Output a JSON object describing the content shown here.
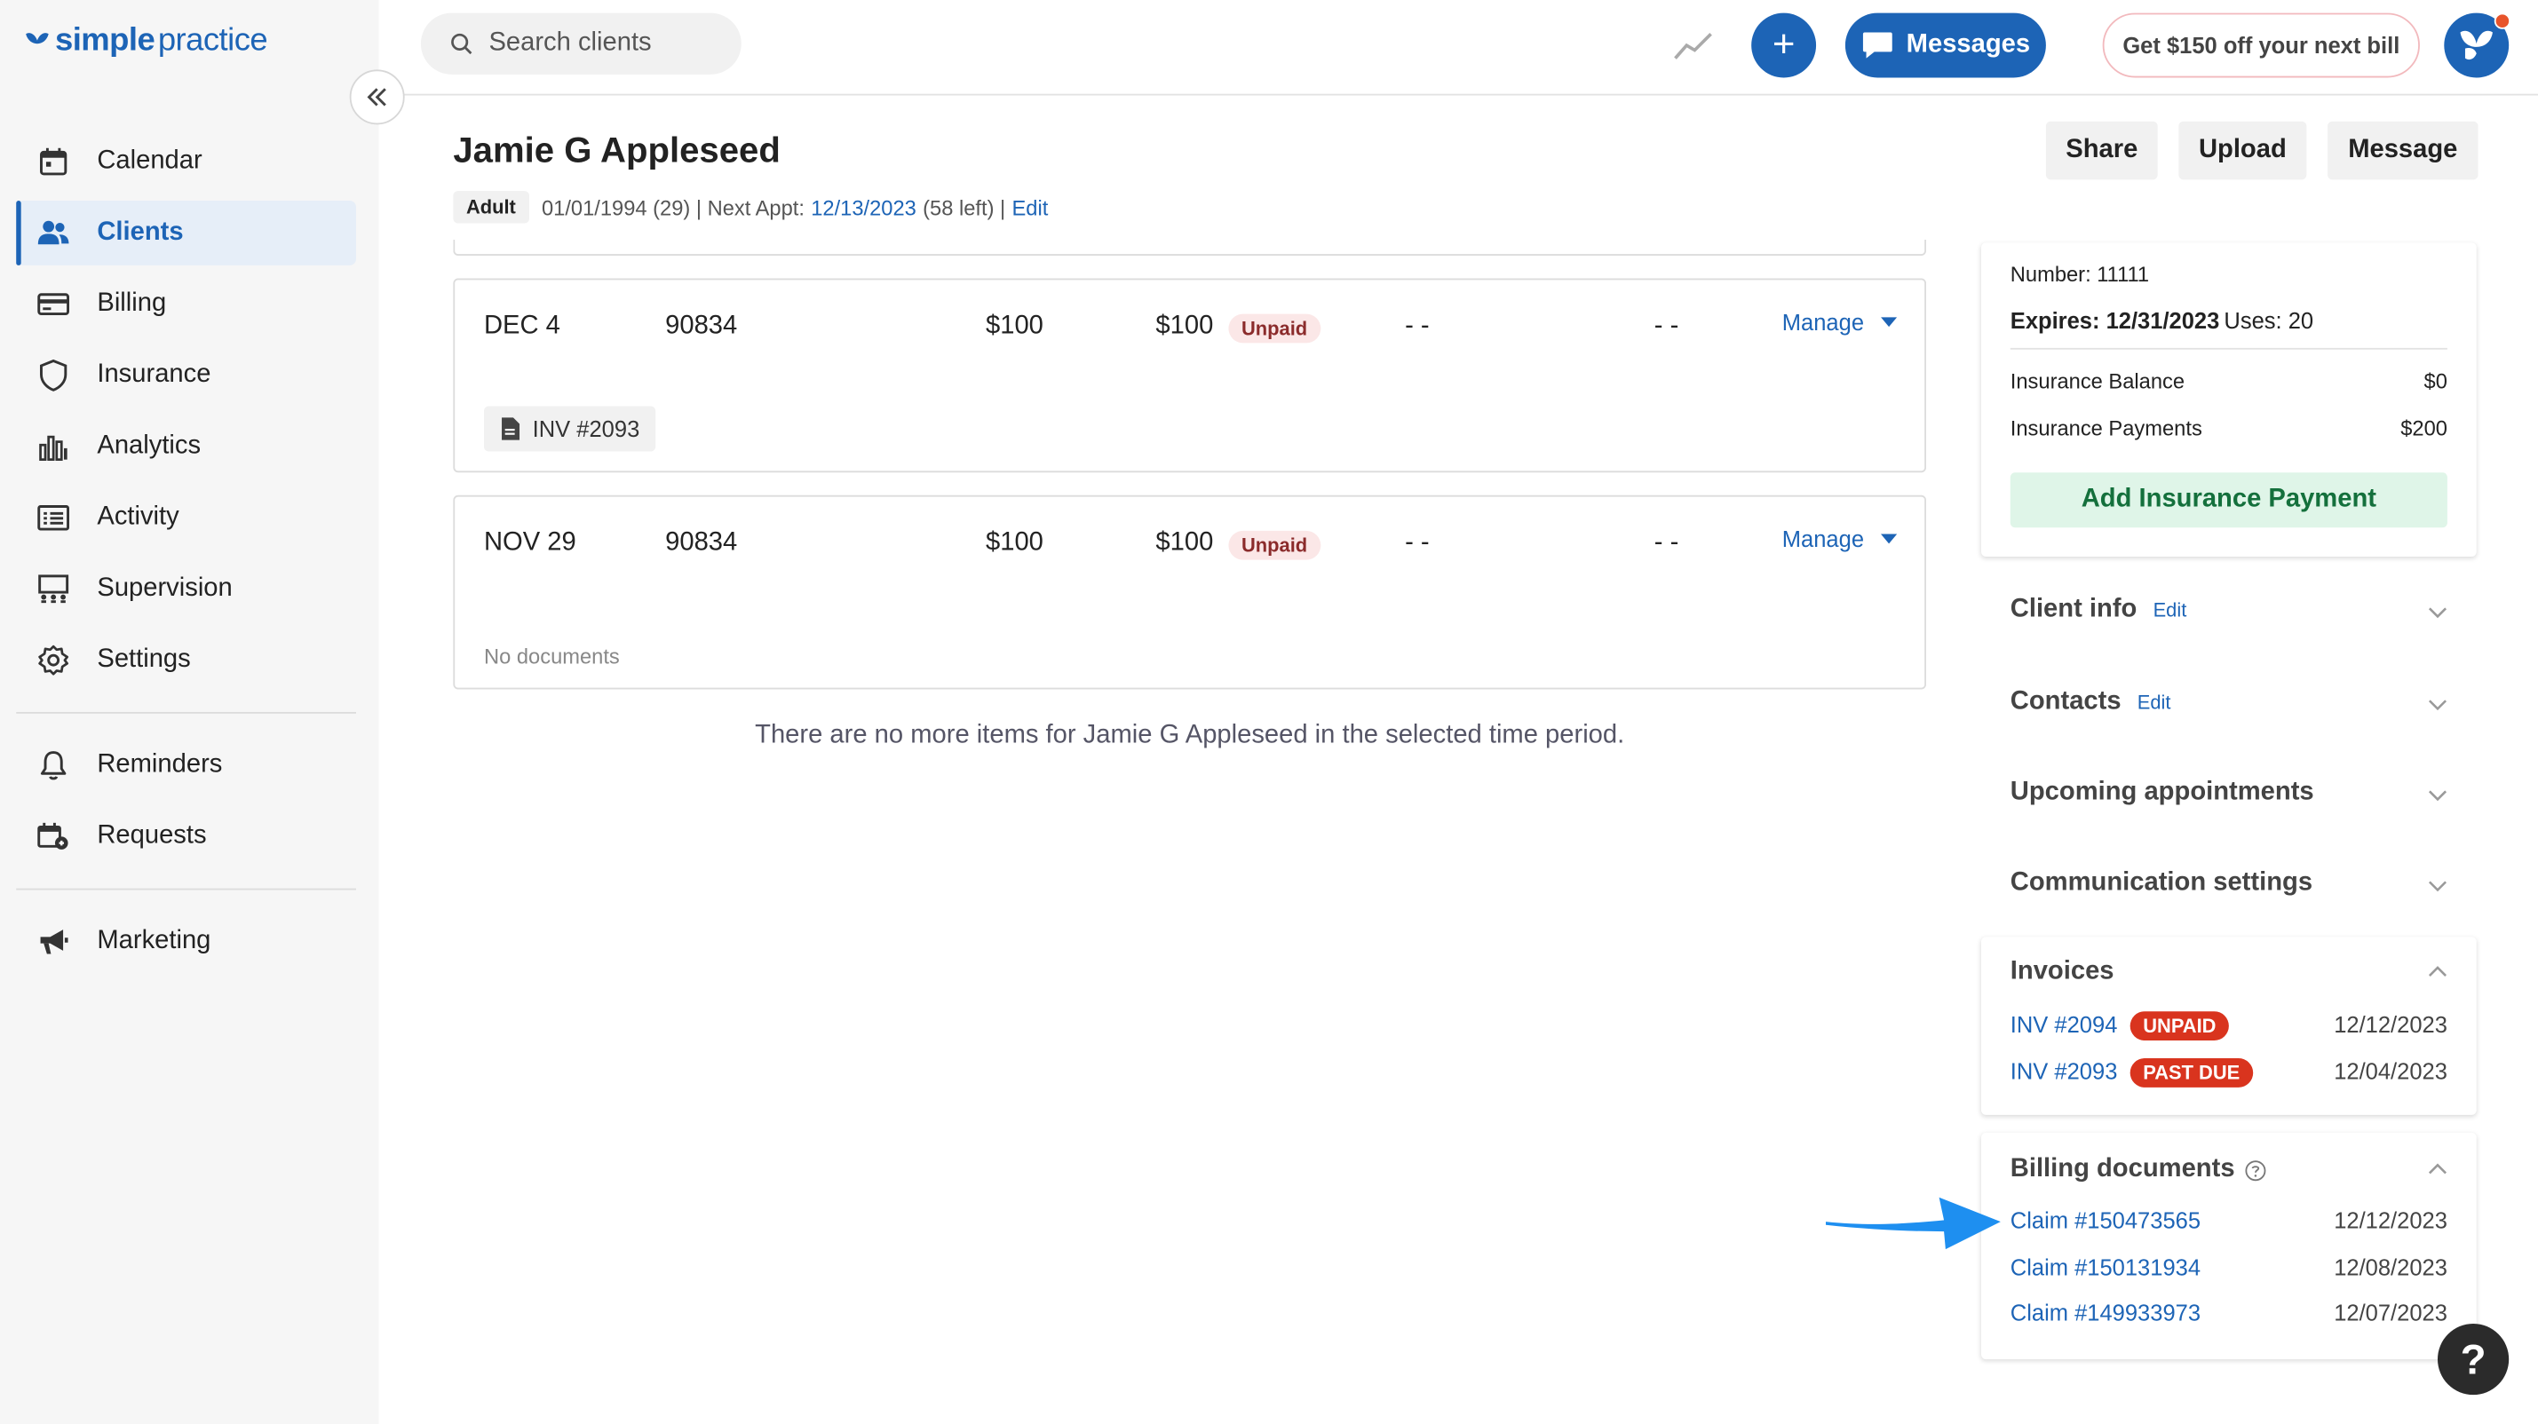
{
  "brand": {
    "part1": "simple",
    "part2": "practice"
  },
  "sidebar": {
    "items": [
      {
        "label": "Calendar",
        "icon": "calendar-icon"
      },
      {
        "label": "Clients",
        "icon": "clients-icon",
        "active": true
      },
      {
        "label": "Billing",
        "icon": "billing-icon"
      },
      {
        "label": "Insurance",
        "icon": "insurance-icon"
      },
      {
        "label": "Analytics",
        "icon": "analytics-icon"
      },
      {
        "label": "Activity",
        "icon": "activity-icon"
      },
      {
        "label": "Supervision",
        "icon": "supervision-icon"
      },
      {
        "label": "Settings",
        "icon": "settings-icon"
      }
    ],
    "items2": [
      {
        "label": "Reminders",
        "icon": "bell-icon"
      },
      {
        "label": "Requests",
        "icon": "requests-icon"
      }
    ],
    "items3": [
      {
        "label": "Marketing",
        "icon": "megaphone-icon"
      }
    ]
  },
  "topbar": {
    "search_placeholder": "Search clients",
    "messages_label": "Messages",
    "promo_label": "Get $150 off your next bill"
  },
  "client": {
    "name": "Jamie G Appleseed",
    "badge": "Adult",
    "meta_prefix": "01/01/1994 (29) | Next Appt:",
    "next_appt": "12/13/2023",
    "meta_suffix": "(58 left) |",
    "edit": "Edit"
  },
  "header_buttons": {
    "share": "Share",
    "upload": "Upload",
    "message": "Message"
  },
  "billing_rows": [
    {
      "date": "DEC 4",
      "code": "90834",
      "fee": "$100",
      "balance": "$100",
      "status": "Unpaid",
      "col5": "- -",
      "col6": "- -",
      "manage": "Manage",
      "doc": "INV #2093"
    },
    {
      "date": "NOV 29",
      "code": "90834",
      "fee": "$100",
      "balance": "$100",
      "status": "Unpaid",
      "col5": "- -",
      "col6": "- -",
      "manage": "Manage",
      "no_docs": "No documents"
    }
  ],
  "end_message": "There are no more items for Jamie G Appleseed in the selected time period.",
  "insurance_card": {
    "number": "Number: 11111",
    "expires_label": "Expires: 12/31/2023",
    "uses": "Uses: 20",
    "balance_label": "Insurance Balance",
    "balance_value": "$0",
    "payments_label": "Insurance Payments",
    "payments_value": "$200",
    "add_payment": "Add Insurance Payment"
  },
  "sections": {
    "client_info": "Client info",
    "client_info_edit": "Edit",
    "contacts": "Contacts",
    "contacts_edit": "Edit",
    "upcoming": "Upcoming appointments",
    "communication": "Communication settings"
  },
  "invoices": {
    "title": "Invoices",
    "items": [
      {
        "id": "INV #2094",
        "status": "UNPAID",
        "date": "12/12/2023"
      },
      {
        "id": "INV #2093",
        "status": "PAST DUE",
        "date": "12/04/2023"
      }
    ]
  },
  "billing_documents": {
    "title": "Billing documents",
    "items": [
      {
        "id": "Claim #150473565",
        "date": "12/12/2023"
      },
      {
        "id": "Claim #150131934",
        "date": "12/08/2023"
      },
      {
        "id": "Claim #149933973",
        "date": "12/07/2023"
      }
    ]
  },
  "help": "?",
  "colors": {
    "accent": "#1d64b6",
    "danger": "#d9341e",
    "success_bg": "#dff5e8",
    "arrow": "#1e8ff0"
  }
}
